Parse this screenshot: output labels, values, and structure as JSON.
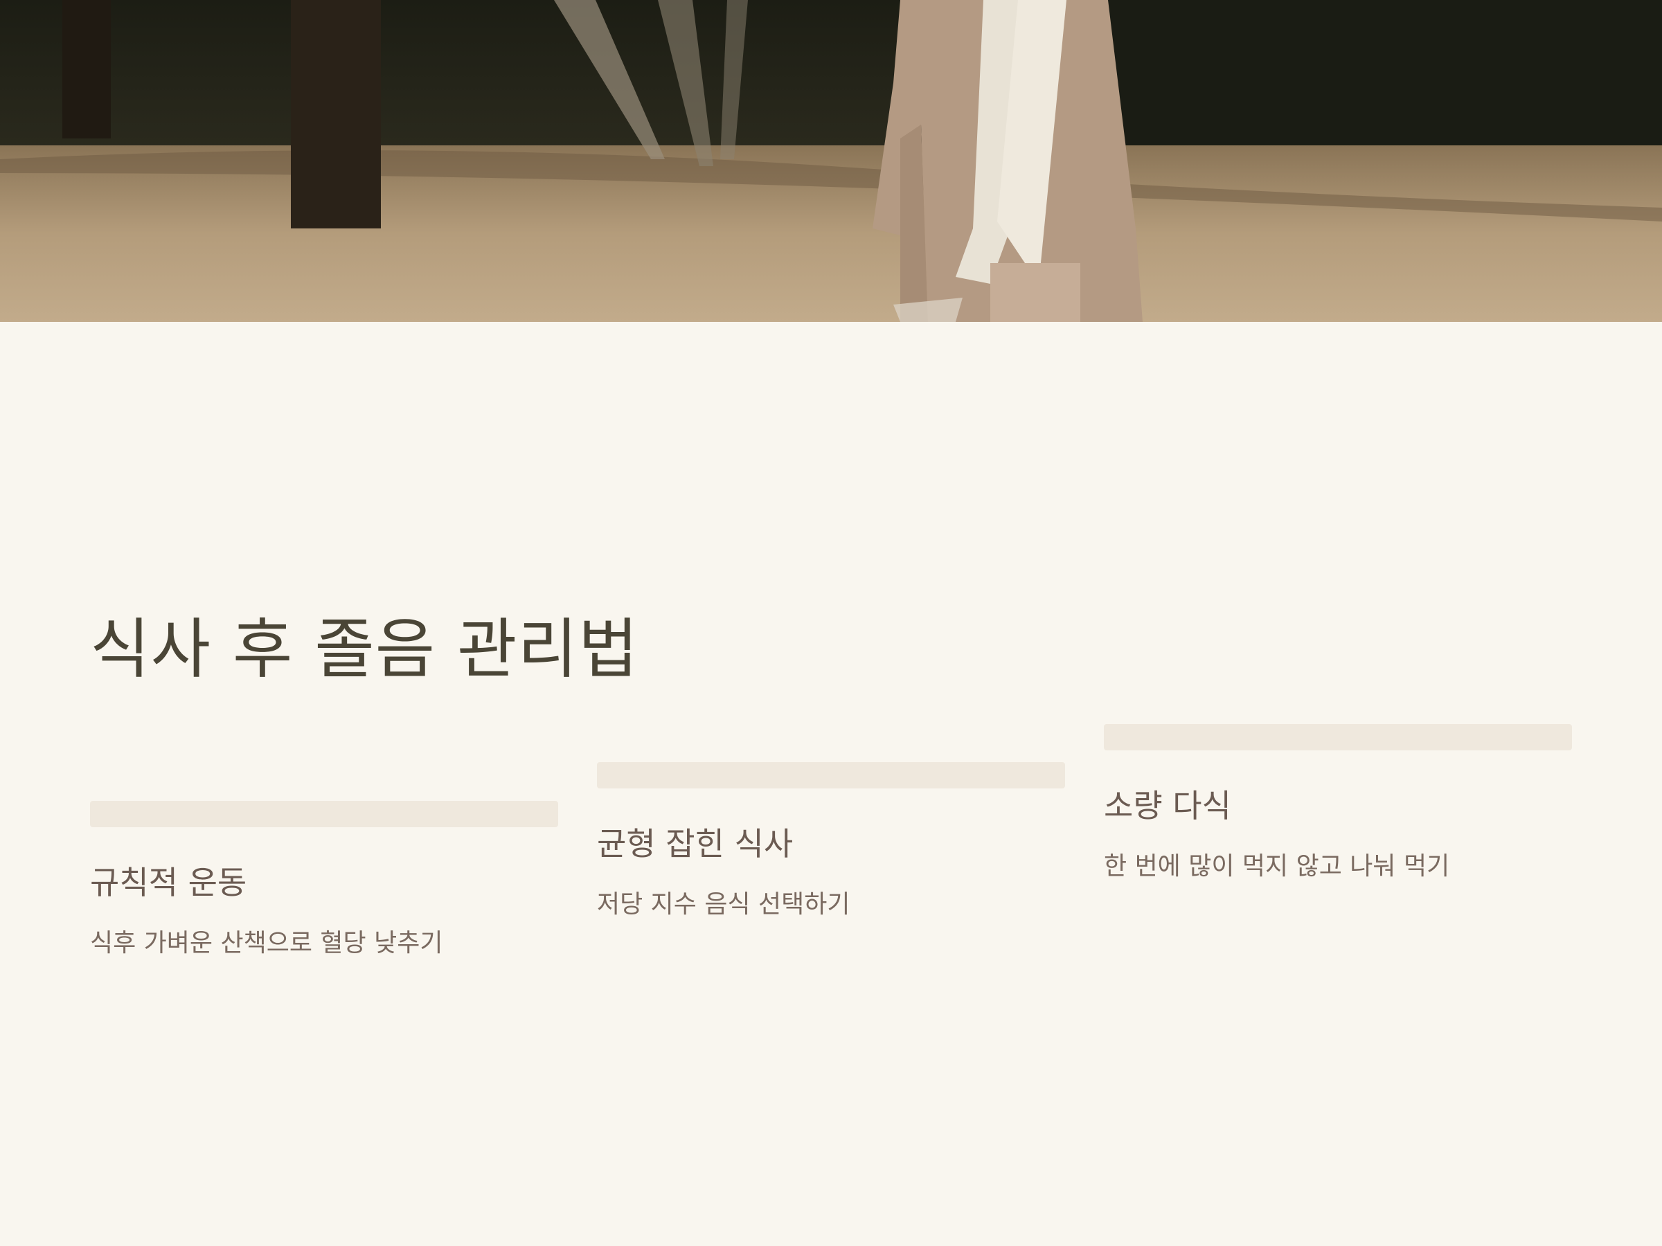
{
  "slide": {
    "title": "식사 후 졸음 관리법"
  },
  "cards": [
    {
      "title": "규칙적 운동",
      "description": "식후 가벼운 산책으로 혈당 낮추기"
    },
    {
      "title": "균형 잡힌 식사",
      "description": "저당 지수 음식 선택하기"
    },
    {
      "title": "소량 다식",
      "description": "한 번에 많이 먹지 않고 나눠 먹기"
    }
  ],
  "colors": {
    "background": "#f9f6ef",
    "title": "#4a4536",
    "card_bar": "#efe8dd",
    "card_text": "#6b5b52"
  }
}
